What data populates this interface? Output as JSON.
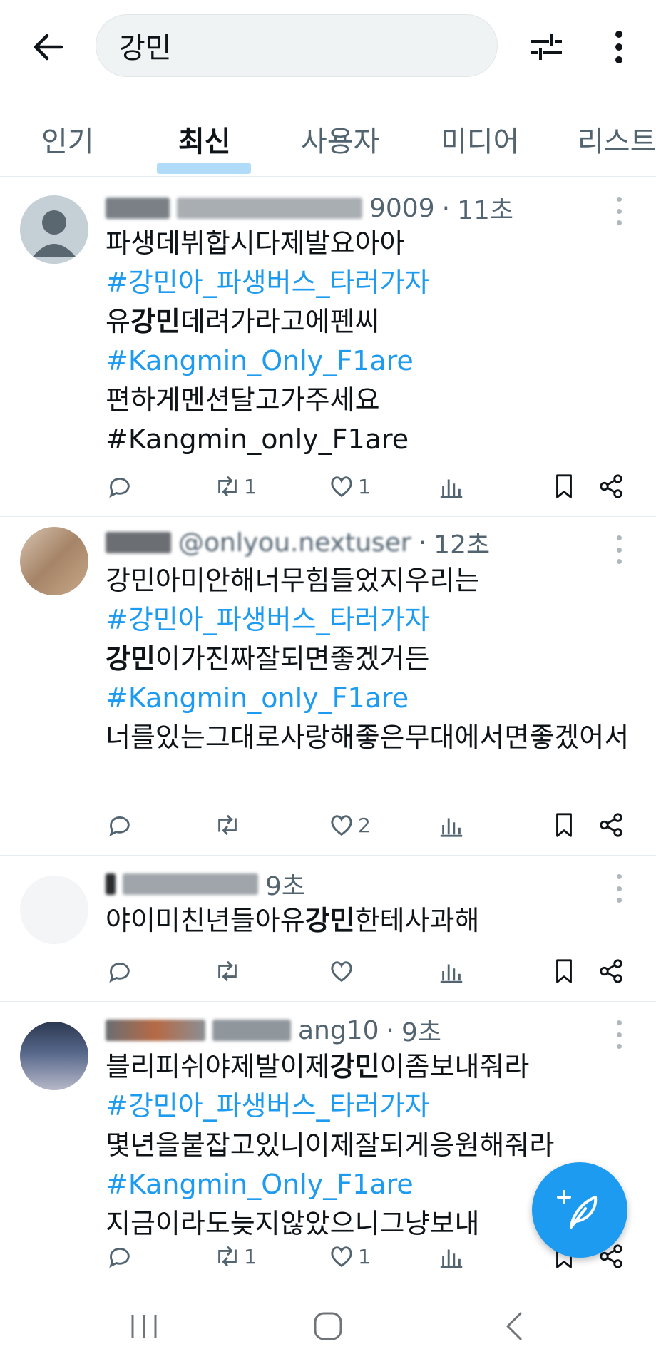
{
  "search": {
    "query": "강민"
  },
  "icons": {
    "back": "arrow-left-icon",
    "filter": "sliders-icon",
    "more": "more-vertical-icon"
  },
  "tabs": [
    {
      "label": "인기",
      "active": false
    },
    {
      "label": "최신",
      "active": true
    },
    {
      "label": "사용자",
      "active": false
    },
    {
      "label": "미디어",
      "active": false
    },
    {
      "label": "리스트",
      "active": false
    }
  ],
  "colors": {
    "accent": "#1d9bf0",
    "text": "#0f1419",
    "muted": "#536471"
  },
  "tweets": [
    {
      "handle_suffix": "9009",
      "time": "11초",
      "lines": [
        {
          "parts": [
            {
              "text": "파생데뷔합시다제발요아아"
            }
          ]
        },
        {
          "parts": [
            {
              "text": "#강민아_파생버스_타러가자",
              "hashtag": true
            }
          ]
        },
        {
          "parts": [
            {
              "text": "유"
            },
            {
              "text": "강민",
              "bold": true
            },
            {
              "text": "데려가라고에펜씨"
            }
          ]
        },
        {
          "parts": [
            {
              "text": "#Kangmin_Only_F1are",
              "hashtag": true
            }
          ]
        },
        {
          "parts": [
            {
              "text": "편하게멘션달고가주세요"
            }
          ]
        },
        {
          "parts": [
            {
              "text": "#Kangmin_only_F1are"
            }
          ]
        }
      ],
      "retweets": "1",
      "likes": "1"
    },
    {
      "handle_suffix": "@onlyou.nextuser",
      "time": "12초",
      "lines": [
        {
          "parts": [
            {
              "text": "강민아미안해너무힘들었지우리는"
            }
          ]
        },
        {
          "parts": [
            {
              "text": "#강민아_파생버스_타러가자",
              "hashtag": true
            }
          ]
        },
        {
          "parts": [
            {
              "text": "강민",
              "bold": true
            },
            {
              "text": "이가진짜잘되면좋겠거든"
            }
          ]
        },
        {
          "parts": [
            {
              "text": "#Kangmin_only_F1are",
              "hashtag": true
            }
          ]
        },
        {
          "parts": [
            {
              "text": "너를있는그대로사랑해좋은무대에서면좋겠어서"
            }
          ],
          "wrap": true
        }
      ],
      "retweets": "",
      "likes": "2"
    },
    {
      "handle_suffix": "",
      "time": "9초",
      "lines": [
        {
          "parts": [
            {
              "text": "야이미친년들아유"
            },
            {
              "text": "강민",
              "bold": true
            },
            {
              "text": "한테사과해"
            }
          ]
        }
      ],
      "retweets": "",
      "likes": ""
    },
    {
      "handle_suffix": "ang10",
      "time": "9초",
      "lines": [
        {
          "parts": [
            {
              "text": "블리피쉬야제발이제"
            },
            {
              "text": "강민",
              "bold": true
            },
            {
              "text": "이좀보내줘라"
            }
          ]
        },
        {
          "parts": [
            {
              "text": "#강민아_파생버스_타러가자",
              "hashtag": true
            }
          ]
        },
        {
          "parts": [
            {
              "text": "몇년을붙잡고있니이제잘되게응원해줘라"
            }
          ]
        },
        {
          "parts": [
            {
              "text": "#Kangmin_Only_F1are",
              "hashtag": true
            }
          ]
        },
        {
          "parts": [
            {
              "text": "지금이라도늦지않았으니그냥보내"
            }
          ]
        }
      ],
      "retweets": "1",
      "likes": "1"
    }
  ]
}
